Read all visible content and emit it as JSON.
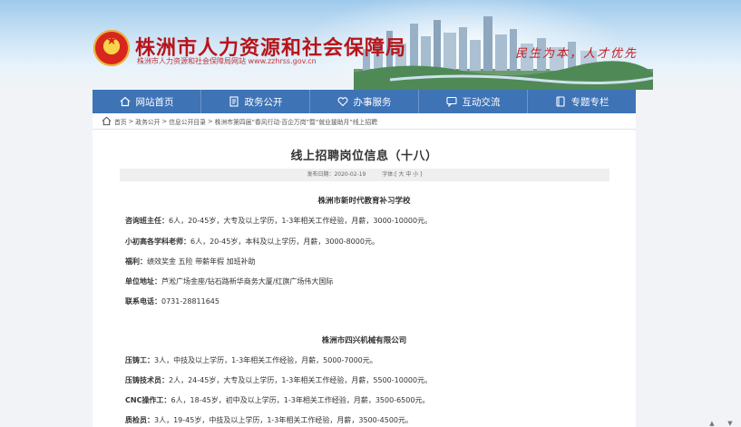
{
  "site": {
    "title": "株洲市人力资源和社会保障局",
    "subtitle": "株洲市人力资源和社会保障局网站 www.zzhrss.gov.cn",
    "slogan": "民生为本，人才优先"
  },
  "nav": [
    {
      "label": "网站首页",
      "icon": "home-icon"
    },
    {
      "label": "政务公开",
      "icon": "document-icon"
    },
    {
      "label": "办事服务",
      "icon": "heart-icon"
    },
    {
      "label": "互动交流",
      "icon": "chat-icon"
    },
    {
      "label": "专题专栏",
      "icon": "book-icon"
    }
  ],
  "breadcrumb": {
    "items": [
      "首页",
      "政务公开",
      "信息公开目录",
      "株洲市第四届“春风行动·百企万岗”暨“就业援助月”线上招聘"
    ],
    "separator": ">"
  },
  "article": {
    "title": "线上招聘岗位信息（十八）",
    "publish_label": "发布日期：2020-02-19",
    "font_label": "字体:[ 大 中 小 ]"
  },
  "companies": [
    {
      "name": "株洲市新时代教育补习学校",
      "lines": [
        {
          "label": "咨询班主任：",
          "text": "6人，20-45岁，大专及以上学历，1-3年相关工作经验，月薪，3000-10000元。"
        },
        {
          "label": "小初高各学科老师：",
          "text": "6人，20-45岁，本科及以上学历，月薪，3000-8000元。"
        },
        {
          "label": "福利：",
          "text": "绩效奖金 五险 带薪年假 加班补助"
        },
        {
          "label": "单位地址：",
          "text": "芦淞广场金座/钻石路新华商务大厦/红旗广场伟大国际"
        },
        {
          "label": "联系电话：",
          "text": "0731-28811645"
        }
      ]
    },
    {
      "name": "株洲市四兴机械有限公司",
      "lines": [
        {
          "label": "压铸工：",
          "text": "3人，中技及以上学历，1-3年相关工作经验，月薪，5000-7000元。"
        },
        {
          "label": "压铸技术员：",
          "text": "2人，24-45岁，大专及以上学历，1-3年相关工作经验，月薪，5500-10000元。"
        },
        {
          "label": "CNC操作工：",
          "text": "6人，18-45岁，初中及以上学历，1-3年相关工作经验，月薪，3500-6500元。"
        },
        {
          "label": "质检员：",
          "text": "3人，19-45岁，中技及以上学历，1-3年相关工作经验，月薪，3500-4500元。"
        }
      ]
    }
  ],
  "colors": {
    "nav_bg": "#3e73b6",
    "brand_red": "#b8141a"
  }
}
